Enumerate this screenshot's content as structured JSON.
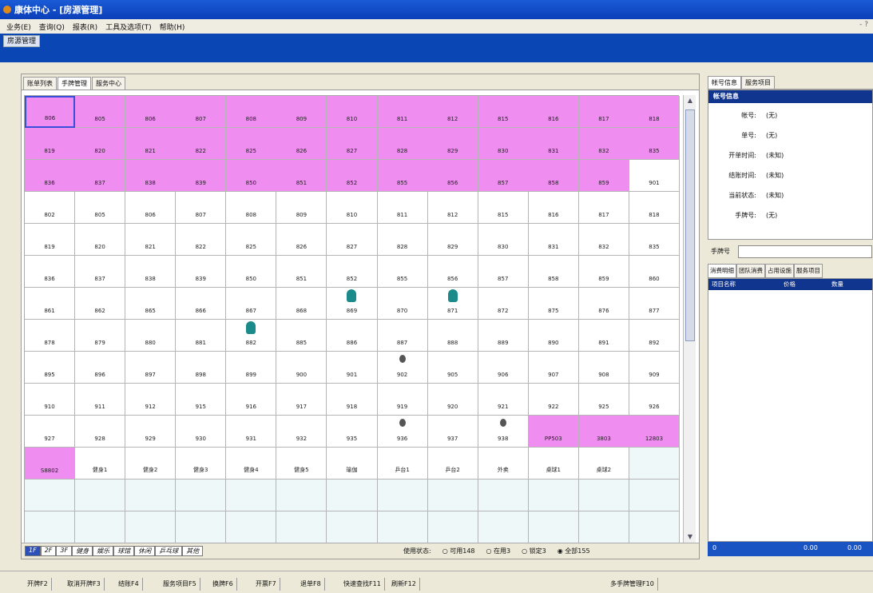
{
  "window": {
    "title": "康体中心 - [房源管理]"
  },
  "menu": [
    "业务(E)",
    "查询(Q)",
    "报表(R)",
    "工具及选项(T)",
    "帮助(H)"
  ],
  "subtab": "房源管理",
  "left_tabs": [
    "账单列表",
    "手牌管理",
    "服务中心"
  ],
  "grid": {
    "rows": [
      [
        [
          "806",
          "pink"
        ],
        [
          "805",
          "pink"
        ],
        [
          "806",
          "pink"
        ],
        [
          "807",
          "pink"
        ],
        [
          "808",
          "pink"
        ],
        [
          "809",
          "pink"
        ],
        [
          "810",
          "pink"
        ],
        [
          "811",
          "pink"
        ],
        [
          "812",
          "pink"
        ],
        [
          "815",
          "pink"
        ],
        [
          "816",
          "pink"
        ],
        [
          "817",
          "pink"
        ],
        [
          "818",
          "pink"
        ]
      ],
      [
        [
          "819",
          "pink"
        ],
        [
          "820",
          "pink"
        ],
        [
          "821",
          "pink"
        ],
        [
          "822",
          "pink"
        ],
        [
          "825",
          "pink"
        ],
        [
          "826",
          "pink"
        ],
        [
          "827",
          "pink"
        ],
        [
          "828",
          "pink"
        ],
        [
          "829",
          "pink"
        ],
        [
          "830",
          "pink"
        ],
        [
          "831",
          "pink"
        ],
        [
          "832",
          "pink"
        ],
        [
          "835",
          "pink"
        ]
      ],
      [
        [
          "836",
          "pink"
        ],
        [
          "837",
          "pink"
        ],
        [
          "838",
          "pink"
        ],
        [
          "839",
          "pink"
        ],
        [
          "850",
          "pink"
        ],
        [
          "851",
          "pink"
        ],
        [
          "852",
          "pink"
        ],
        [
          "855",
          "pink"
        ],
        [
          "856",
          "pink"
        ],
        [
          "857",
          "pink"
        ],
        [
          "858",
          "pink"
        ],
        [
          "859",
          "pink"
        ],
        [
          "901",
          "white"
        ]
      ],
      [
        [
          "802",
          "white"
        ],
        [
          "805",
          "white"
        ],
        [
          "806",
          "white"
        ],
        [
          "807",
          "white"
        ],
        [
          "808",
          "white"
        ],
        [
          "809",
          "white"
        ],
        [
          "810",
          "white"
        ],
        [
          "811",
          "white"
        ],
        [
          "812",
          "white"
        ],
        [
          "815",
          "white"
        ],
        [
          "816",
          "white"
        ],
        [
          "817",
          "white"
        ],
        [
          "818",
          "white"
        ]
      ],
      [
        [
          "819",
          "white"
        ],
        [
          "820",
          "white"
        ],
        [
          "821",
          "white"
        ],
        [
          "822",
          "white"
        ],
        [
          "825",
          "white"
        ],
        [
          "826",
          "white"
        ],
        [
          "827",
          "white"
        ],
        [
          "828",
          "white"
        ],
        [
          "829",
          "white"
        ],
        [
          "830",
          "white"
        ],
        [
          "831",
          "white"
        ],
        [
          "832",
          "white"
        ],
        [
          "835",
          "white"
        ]
      ],
      [
        [
          "836",
          "white"
        ],
        [
          "837",
          "white"
        ],
        [
          "838",
          "white"
        ],
        [
          "839",
          "white"
        ],
        [
          "850",
          "white"
        ],
        [
          "851",
          "white"
        ],
        [
          "852",
          "white"
        ],
        [
          "855",
          "white"
        ],
        [
          "856",
          "white"
        ],
        [
          "857",
          "white"
        ],
        [
          "858",
          "white"
        ],
        [
          "859",
          "white"
        ],
        [
          "860",
          "white"
        ]
      ],
      [
        [
          "861",
          "white"
        ],
        [
          "862",
          "white"
        ],
        [
          "865",
          "white"
        ],
        [
          "866",
          "white"
        ],
        [
          "867",
          "white"
        ],
        [
          "868",
          "white"
        ],
        [
          "869",
          "white",
          "occ"
        ],
        [
          "870",
          "white"
        ],
        [
          "871",
          "white",
          "occ"
        ],
        [
          "872",
          "white"
        ],
        [
          "875",
          "white"
        ],
        [
          "876",
          "white"
        ],
        [
          "877",
          "white"
        ]
      ],
      [
        [
          "878",
          "white"
        ],
        [
          "879",
          "white"
        ],
        [
          "880",
          "white"
        ],
        [
          "881",
          "white"
        ],
        [
          "882",
          "white",
          "occ"
        ],
        [
          "885",
          "white"
        ],
        [
          "886",
          "white"
        ],
        [
          "887",
          "white"
        ],
        [
          "888",
          "white"
        ],
        [
          "889",
          "white"
        ],
        [
          "890",
          "white"
        ],
        [
          "891",
          "white"
        ],
        [
          "892",
          "white"
        ]
      ],
      [
        [
          "895",
          "white"
        ],
        [
          "896",
          "white"
        ],
        [
          "897",
          "white"
        ],
        [
          "898",
          "white"
        ],
        [
          "899",
          "white"
        ],
        [
          "900",
          "white"
        ],
        [
          "901",
          "white"
        ],
        [
          "902",
          "white",
          "gear"
        ],
        [
          "905",
          "white"
        ],
        [
          "906",
          "white"
        ],
        [
          "907",
          "white"
        ],
        [
          "908",
          "white"
        ],
        [
          "909",
          "white"
        ]
      ],
      [
        [
          "910",
          "white"
        ],
        [
          "911",
          "white"
        ],
        [
          "912",
          "white"
        ],
        [
          "915",
          "white"
        ],
        [
          "916",
          "white"
        ],
        [
          "917",
          "white"
        ],
        [
          "918",
          "white"
        ],
        [
          "919",
          "white"
        ],
        [
          "920",
          "white"
        ],
        [
          "921",
          "white"
        ],
        [
          "922",
          "white"
        ],
        [
          "925",
          "white"
        ],
        [
          "926",
          "white"
        ]
      ],
      [
        [
          "927",
          "white"
        ],
        [
          "928",
          "white"
        ],
        [
          "929",
          "white"
        ],
        [
          "930",
          "white"
        ],
        [
          "931",
          "white"
        ],
        [
          "932",
          "white"
        ],
        [
          "935",
          "white"
        ],
        [
          "936",
          "white",
          "gear"
        ],
        [
          "937",
          "white"
        ],
        [
          "938",
          "white",
          "gear"
        ],
        [
          "PP503",
          "pink"
        ],
        [
          "3803",
          "pink"
        ],
        [
          "12803",
          "pink"
        ]
      ],
      [
        [
          "S8802",
          "pink"
        ],
        [
          "健身1",
          "white"
        ],
        [
          "健身2",
          "white"
        ],
        [
          "健身3",
          "white"
        ],
        [
          "健身4",
          "white"
        ],
        [
          "健身5",
          "white"
        ],
        [
          "瑜伽",
          "white"
        ],
        [
          "乒台1",
          "white"
        ],
        [
          "乒台2",
          "white"
        ],
        [
          "外卖",
          "white"
        ],
        [
          "桌球1",
          "white"
        ],
        [
          "桌球2",
          "white"
        ],
        [
          "",
          "light"
        ]
      ],
      [
        [
          "",
          "light"
        ],
        [
          "",
          "light"
        ],
        [
          "",
          "light"
        ],
        [
          "",
          "light"
        ],
        [
          "",
          "light"
        ],
        [
          "",
          "light"
        ],
        [
          "",
          "light"
        ],
        [
          "",
          "light"
        ],
        [
          "",
          "light"
        ],
        [
          "",
          "light"
        ],
        [
          "",
          "light"
        ],
        [
          "",
          "light"
        ],
        [
          "",
          "light"
        ]
      ],
      [
        [
          "",
          "light"
        ],
        [
          "",
          "light"
        ],
        [
          "",
          "light"
        ],
        [
          "",
          "light"
        ],
        [
          "",
          "light"
        ],
        [
          "",
          "light"
        ],
        [
          "",
          "light"
        ],
        [
          "",
          "light"
        ],
        [
          "",
          "light"
        ],
        [
          "",
          "light"
        ],
        [
          "",
          "light"
        ],
        [
          "",
          "light"
        ],
        [
          "",
          "light"
        ]
      ]
    ]
  },
  "floor_tabs": [
    "1F",
    "2F",
    "3F",
    "健身",
    "娱乐",
    "球馆",
    "休闲",
    "乒乓球",
    "其他"
  ],
  "status_filter": {
    "label": "使用状态:",
    "options": [
      "可用148",
      "在用3",
      "锁定3",
      "全部155"
    ],
    "selected": 3
  },
  "right_tabs": [
    "帐号信息",
    "服务项目"
  ],
  "info": {
    "header": "帐号信息",
    "rows": [
      {
        "k": "帐号:",
        "v": "(无)"
      },
      {
        "k": "单号:",
        "v": "(无)"
      },
      {
        "k": "开单时间:",
        "v": "(未知)"
      },
      {
        "k": "结账时间:",
        "v": "(未知)"
      },
      {
        "k": "当前状态:",
        "v": "(未知)"
      },
      {
        "k": "手牌号:",
        "v": "(无)"
      }
    ]
  },
  "card": {
    "label": "手牌号",
    "value": ""
  },
  "consume_tabs": [
    "消费明细",
    "团队消费",
    "占用设施",
    "服务项目"
  ],
  "consume_headers": [
    "项目名称",
    "价格",
    "数量"
  ],
  "totals": {
    "a": "0",
    "b": "0.00",
    "c": "0.00"
  },
  "bottom_buttons": [
    "开牌F2",
    "取消开牌F3",
    "结账F4",
    "服务项目F5",
    "换牌F6",
    "开票F7",
    "退单F8",
    "快速查找F11",
    "刷新F12",
    "多手牌管理F10"
  ]
}
